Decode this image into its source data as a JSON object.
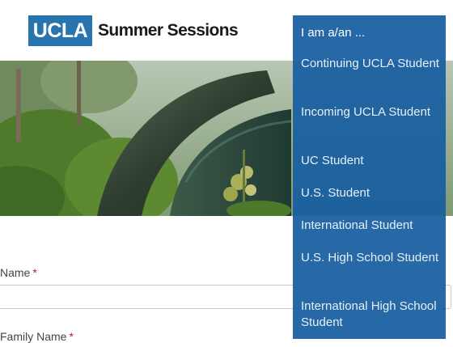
{
  "header": {
    "logo_mark": "UCLA",
    "logo_text": "Summer Sessions"
  },
  "form": {
    "name_label": "Name",
    "family_name_label": "Family Name",
    "required_mark": "*",
    "name_value": ""
  },
  "dropdown": {
    "title": "I am a/an ...",
    "items": [
      {
        "label": "Continuing UCLA Student"
      },
      {
        "label": "Incoming UCLA Student"
      },
      {
        "label": "UC Student"
      },
      {
        "label": "U.S. Student"
      },
      {
        "label": "International Student"
      },
      {
        "label": "U.S. High School Student"
      },
      {
        "label": "International High School Student"
      }
    ]
  },
  "colors": {
    "brand_blue": "#2774ae",
    "dropdown_bg": "#175ea0",
    "required": "#c8102e"
  }
}
